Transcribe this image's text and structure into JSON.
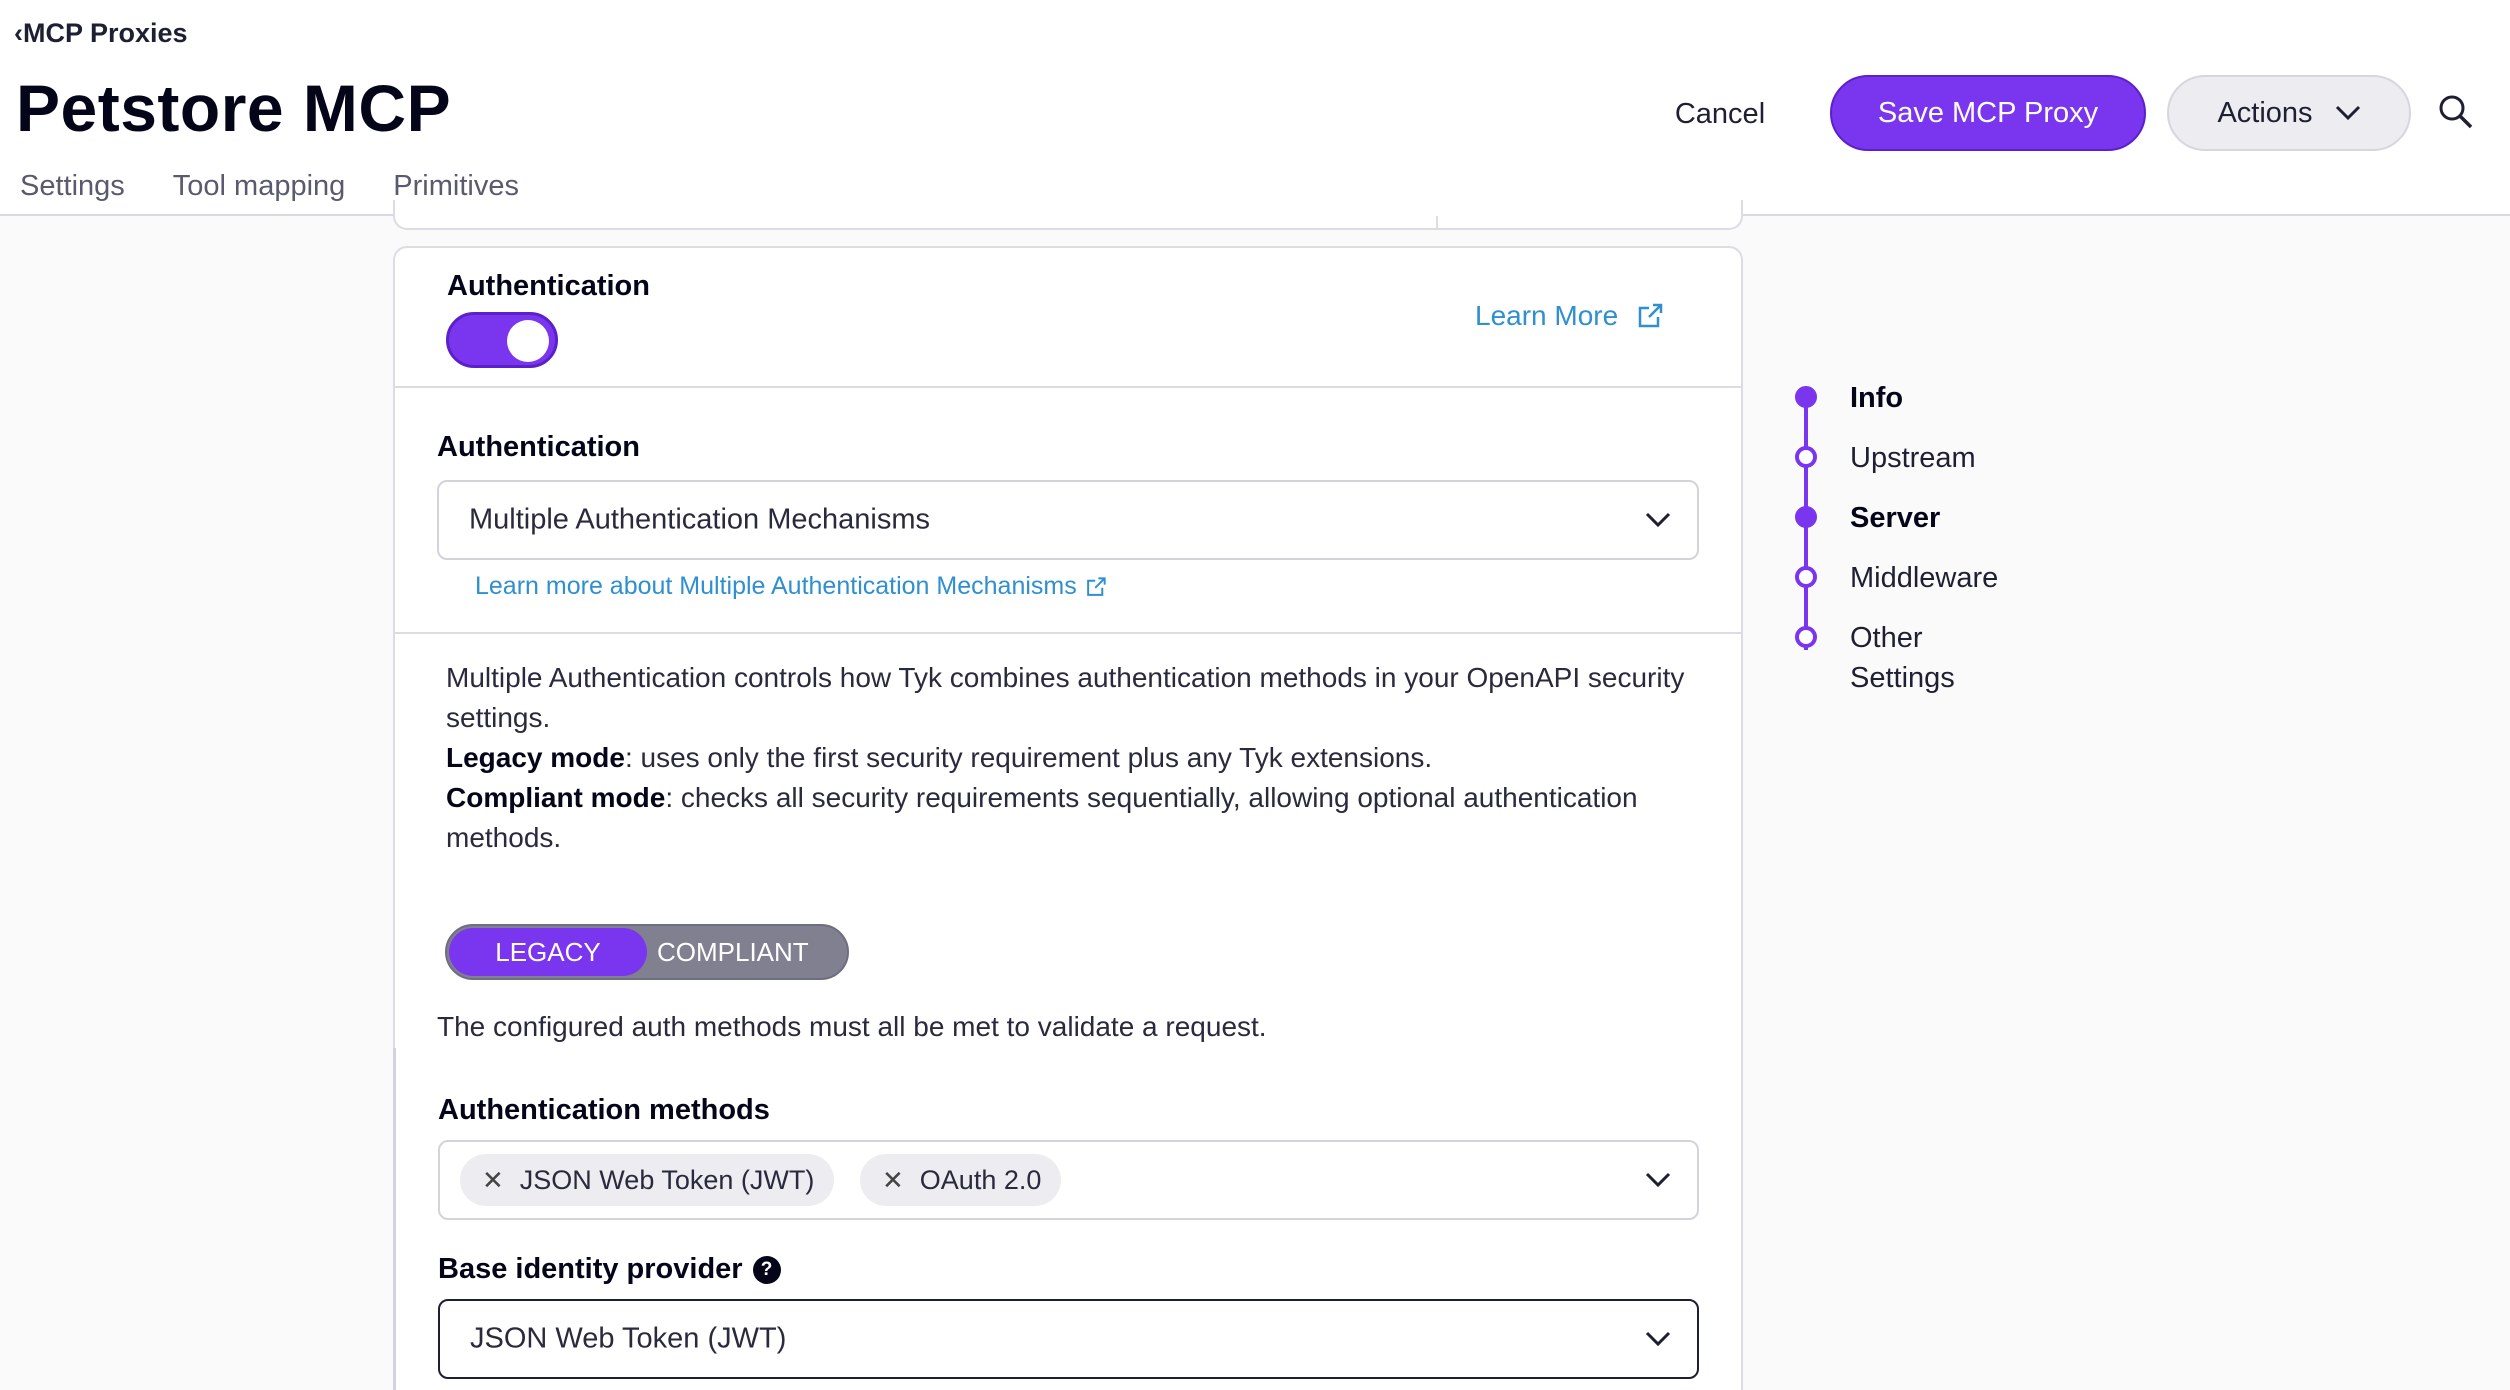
{
  "header": {
    "back_label": "MCP Proxies",
    "title": "Petstore MCP",
    "tabs": [
      "Settings",
      "Tool mapping",
      "Primitives"
    ],
    "cancel_label": "Cancel",
    "save_label": "Save MCP Proxy",
    "actions_label": "Actions"
  },
  "auth": {
    "section_title": "Authentication",
    "enabled": true,
    "learn_more": "Learn More",
    "field_label": "Authentication",
    "selected": "Multiple Authentication Mechanisms",
    "help_link": "Learn more about Multiple Authentication Mechanisms",
    "desc_line1": "Multiple Authentication controls how Tyk combines authentication methods in your OpenAPI security settings.",
    "legacy_term": "Legacy mode",
    "legacy_desc": ": uses only the first security requirement plus any Tyk extensions.",
    "compliant_term": "Compliant mode",
    "compliant_desc": ": checks all security requirements sequentially, allowing optional authentication methods.",
    "mode_options": [
      "LEGACY",
      "COMPLIANT"
    ],
    "mode_selected": "LEGACY",
    "mode_note": "The configured auth methods must all be met to validate a request.",
    "methods_label": "Authentication methods",
    "methods": [
      "JSON Web Token (JWT)",
      "OAuth 2.0"
    ],
    "base_provider_label": "Base identity provider",
    "base_provider_value": "JSON Web Token (JWT)"
  },
  "section_nav": {
    "items": [
      {
        "label": "Info",
        "state": "filled"
      },
      {
        "label": "Upstream",
        "state": "hollow"
      },
      {
        "label": "Server",
        "state": "filled"
      },
      {
        "label": "Middleware",
        "state": "hollow"
      },
      {
        "label": "Other Settings",
        "state": "hollow"
      }
    ]
  },
  "colors": {
    "accent": "#7a35ee",
    "link": "#2f8fcf"
  }
}
